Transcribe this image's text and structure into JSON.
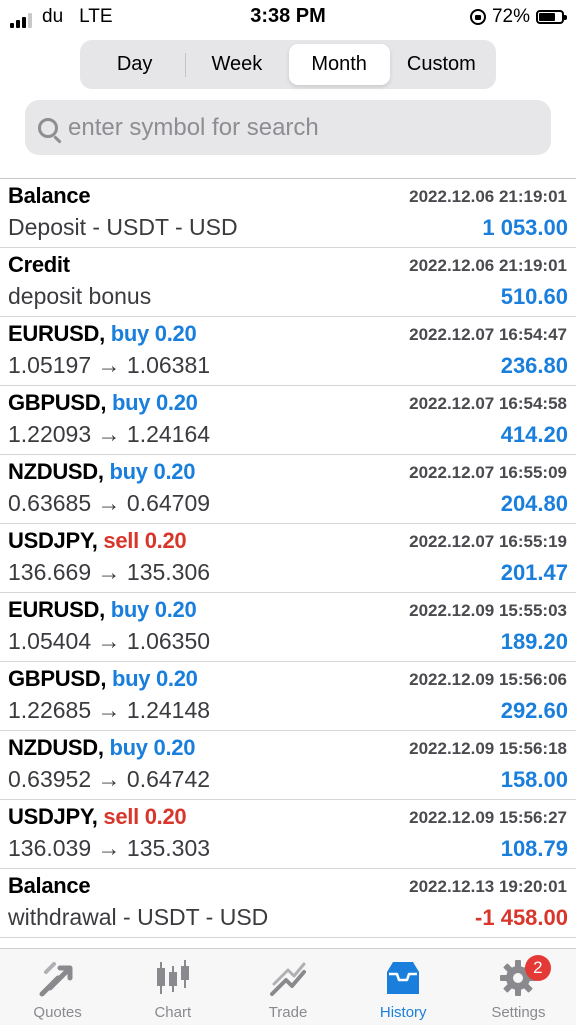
{
  "status_bar": {
    "carrier": "du",
    "network": "LTE",
    "time": "3:38 PM",
    "battery_text": "72%",
    "battery_level": 0.72
  },
  "period_tabs": [
    {
      "label": "Day",
      "active": false
    },
    {
      "label": "Week",
      "active": false
    },
    {
      "label": "Month",
      "active": true
    },
    {
      "label": "Custom",
      "active": false
    }
  ],
  "search": {
    "placeholder": "enter symbol for search",
    "value": ""
  },
  "history": [
    {
      "symbol": "Balance",
      "direction": "",
      "volume": "",
      "time": "2022.12.06 21:19:01",
      "detail": "Deposit - USDT - USD",
      "amount": "1 053.00",
      "sign": "pos"
    },
    {
      "symbol": "Credit",
      "direction": "",
      "volume": "",
      "time": "2022.12.06 21:19:01",
      "detail": "deposit bonus",
      "amount": "510.60",
      "sign": "pos"
    },
    {
      "symbol": "EURUSD,",
      "direction": "buy",
      "volume": "0.20",
      "time": "2022.12.07 16:54:47",
      "detail": "1.05197 → 1.06381",
      "amount": "236.80",
      "sign": "pos"
    },
    {
      "symbol": "GBPUSD,",
      "direction": "buy",
      "volume": "0.20",
      "time": "2022.12.07 16:54:58",
      "detail": "1.22093 → 1.24164",
      "amount": "414.20",
      "sign": "pos"
    },
    {
      "symbol": "NZDUSD,",
      "direction": "buy",
      "volume": "0.20",
      "time": "2022.12.07 16:55:09",
      "detail": "0.63685 → 0.64709",
      "amount": "204.80",
      "sign": "pos"
    },
    {
      "symbol": "USDJPY,",
      "direction": "sell",
      "volume": "0.20",
      "time": "2022.12.07 16:55:19",
      "detail": "136.669 → 135.306",
      "amount": "201.47",
      "sign": "pos"
    },
    {
      "symbol": "EURUSD,",
      "direction": "buy",
      "volume": "0.20",
      "time": "2022.12.09 15:55:03",
      "detail": "1.05404 → 1.06350",
      "amount": "189.20",
      "sign": "pos"
    },
    {
      "symbol": "GBPUSD,",
      "direction": "buy",
      "volume": "0.20",
      "time": "2022.12.09 15:56:06",
      "detail": "1.22685 → 1.24148",
      "amount": "292.60",
      "sign": "pos"
    },
    {
      "symbol": "NZDUSD,",
      "direction": "buy",
      "volume": "0.20",
      "time": "2022.12.09 15:56:18",
      "detail": "0.63952 → 0.64742",
      "amount": "158.00",
      "sign": "pos"
    },
    {
      "symbol": "USDJPY,",
      "direction": "sell",
      "volume": "0.20",
      "time": "2022.12.09 15:56:27",
      "detail": "136.039 → 135.303",
      "amount": "108.79",
      "sign": "pos"
    },
    {
      "symbol": "Balance",
      "direction": "",
      "volume": "",
      "time": "2022.12.13 19:20:01",
      "detail": "withdrawal - USDT - USD",
      "amount": "-1 458.00",
      "sign": "neg"
    }
  ],
  "tabbar": {
    "items": [
      {
        "label": "Quotes",
        "icon": "quotes-icon",
        "active": false
      },
      {
        "label": "Chart",
        "icon": "candlestick-chart-icon",
        "active": false
      },
      {
        "label": "Trade",
        "icon": "trade-icon",
        "active": false
      },
      {
        "label": "History",
        "icon": "inbox-history-icon",
        "active": true
      },
      {
        "label": "Settings",
        "icon": "gear-icon",
        "active": false,
        "badge": "2"
      }
    ]
  },
  "colors": {
    "accent": "#1a7fdc",
    "sell": "#d9362b",
    "inactive": "#8a8a8e",
    "badge": "#e53935"
  }
}
